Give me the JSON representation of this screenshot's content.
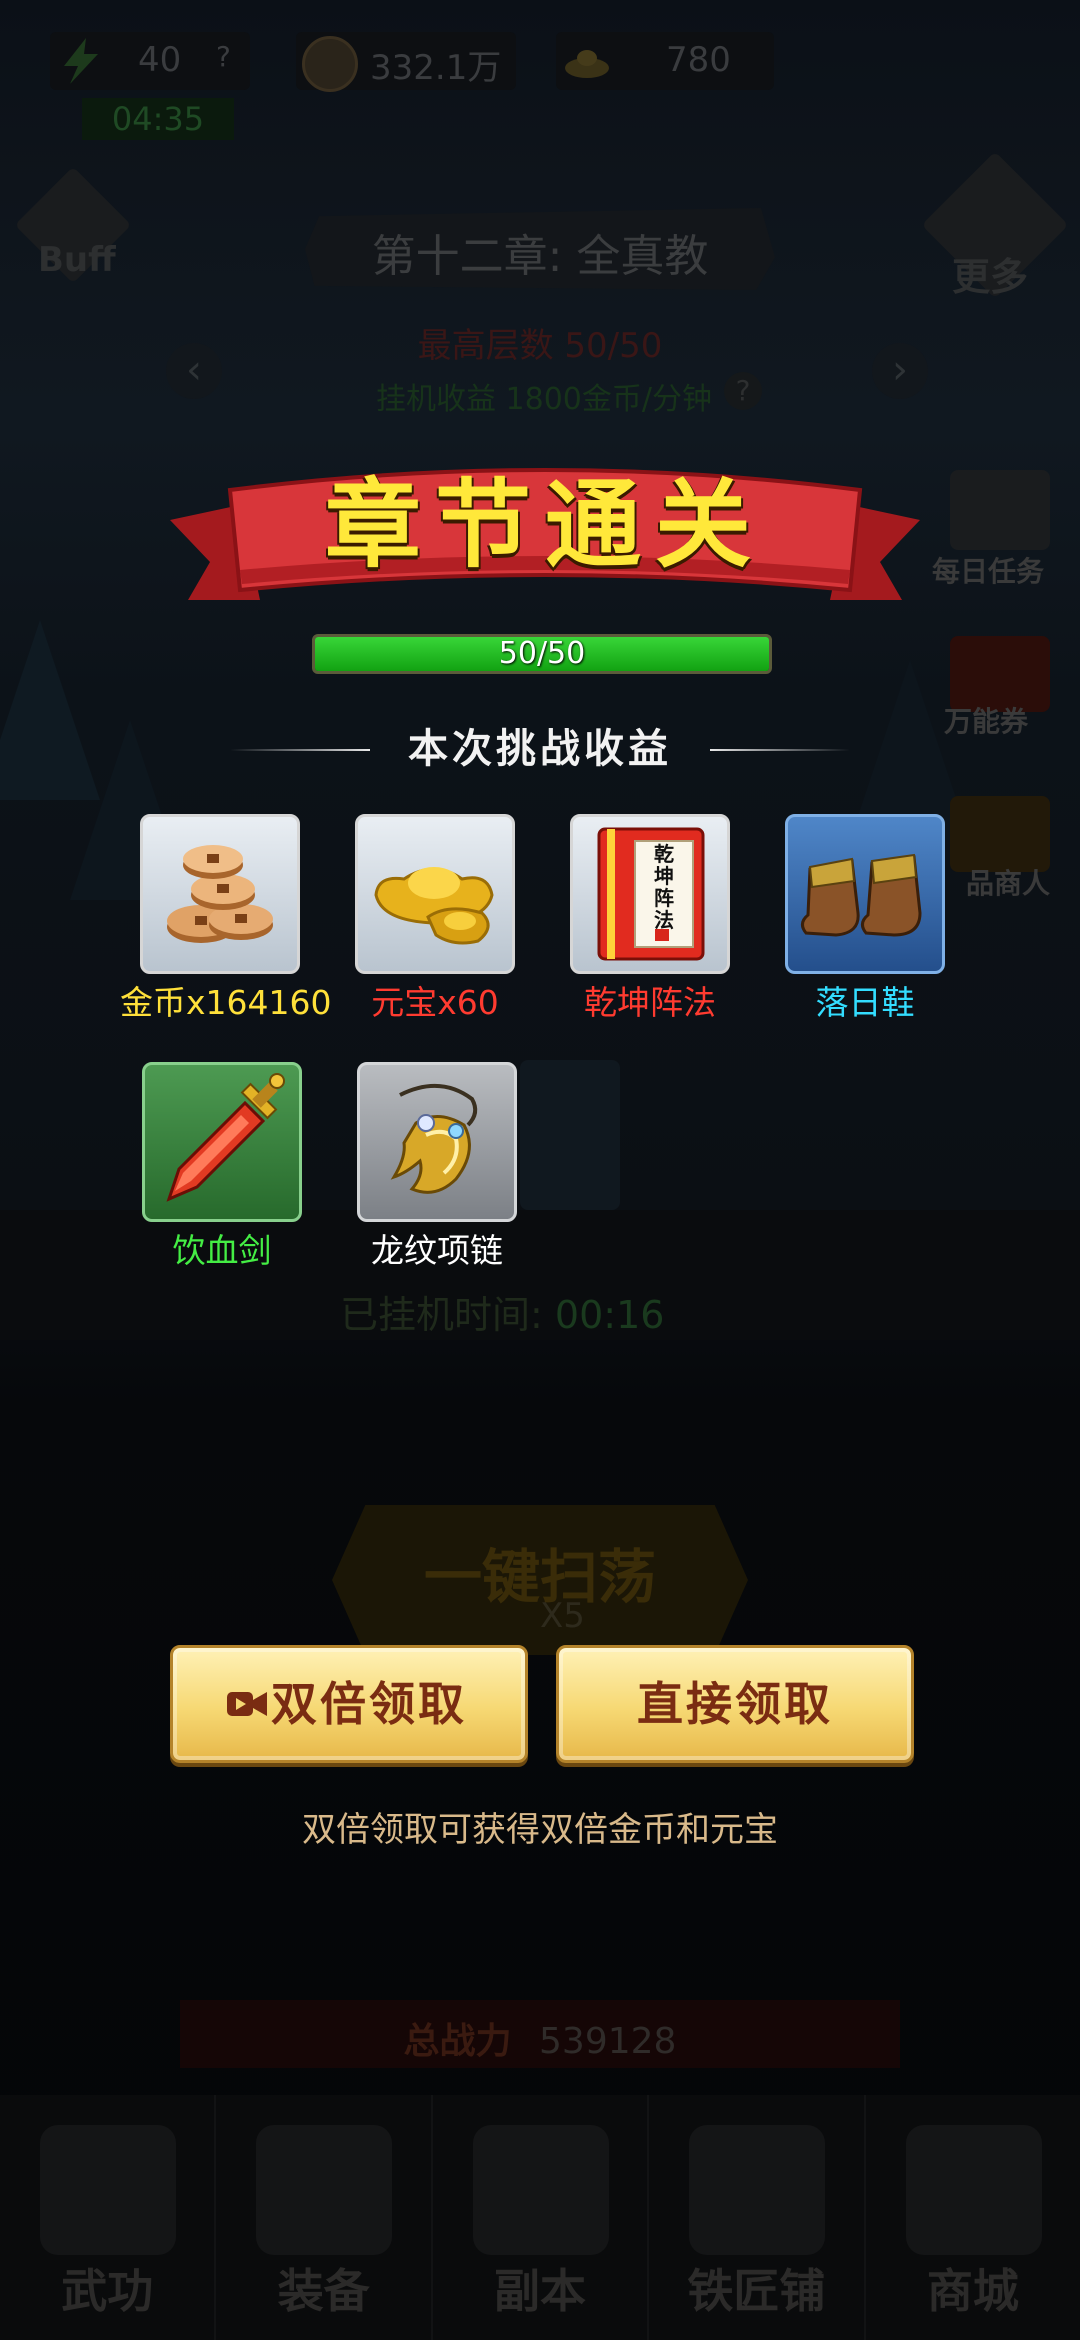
{
  "hud": {
    "stamina": "40",
    "stamina_help": "?",
    "timer": "04:35",
    "coins": "332.1万",
    "ingots": "780"
  },
  "buff_label": "Buff",
  "more_label": "更多",
  "chapter": {
    "title": "第十二章: 全真教",
    "max_floor_label": "最高层数",
    "max_floor_value": "50/50",
    "idle_income": "挂机收益 1800金币/分钟",
    "help": "?"
  },
  "side_menu": [
    "每日任务",
    "万能券",
    "品商人"
  ],
  "idle_time_label": "已挂机时间:",
  "idle_time_value": "00:16",
  "sweep": {
    "label": "一键扫荡",
    "cost": "X5"
  },
  "power": {
    "label": "总战力",
    "value": "539128"
  },
  "bottom_nav": [
    "武功",
    "装备",
    "副本",
    "铁匠铺",
    "商城"
  ],
  "overlay": {
    "banner_title": "章节通关",
    "progress_text": "50/50",
    "progress_fraction": 1.0,
    "rewards_title": "本次挑战收益",
    "rewards": [
      {
        "icon": "copper-coins-icon",
        "label": "金币x164160",
        "color": "#ffe03a"
      },
      {
        "icon": "gold-ingot-icon",
        "label": "元宝x60",
        "color": "#ff3b30"
      },
      {
        "icon": "scroll-book-icon",
        "label": "乾坤阵法",
        "color": "#ff3b30",
        "book_text": "乾坤阵法"
      },
      {
        "icon": "boots-icon",
        "label": "落日鞋",
        "color": "#33ddff"
      },
      {
        "icon": "sword-icon",
        "label": "饮血剑",
        "color": "#44ee44"
      },
      {
        "icon": "necklace-icon",
        "label": "龙纹项链",
        "color": "#ffffff"
      }
    ],
    "double_claim_label": "双倍领取",
    "direct_claim_label": "直接领取",
    "hint": "双倍领取可获得双倍金币和元宝"
  }
}
